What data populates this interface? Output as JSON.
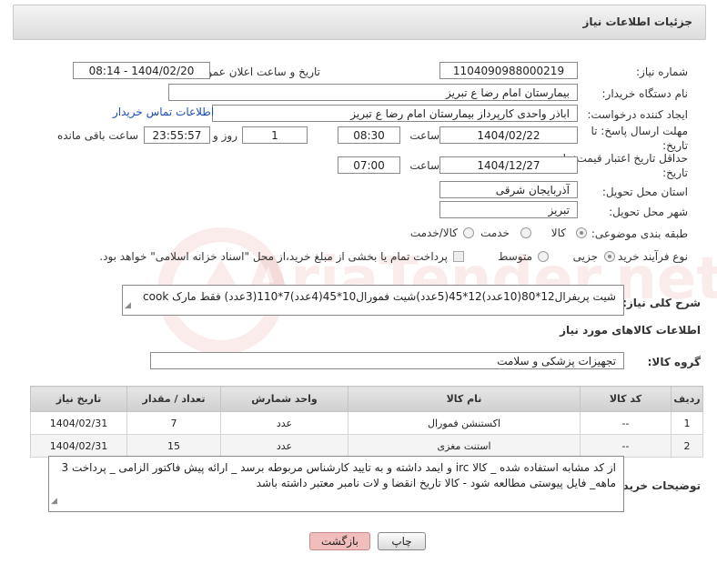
{
  "header": {
    "title": "جزئیات اطلاعات نیاز"
  },
  "fields": {
    "need_number_label": "شماره نیاز:",
    "need_number": "1104090988000219",
    "announce_label": "تاریخ و ساعت اعلان عمومی:",
    "announce_value": "1404/02/20 - 08:14",
    "buyer_label": "نام دستگاه خریدار:",
    "buyer_value": "بیمارستان امام رضا  ع  تبریز",
    "creator_label": "ایجاد کننده درخواست:",
    "creator_value": "اباذر واحدی کارپرداز بیمارستان امام رضا  ع  تبریز",
    "contact_link": "اطلاعات تماس خریدار",
    "reply_deadline_label": "مهلت ارسال پاسخ: تا تاریخ:",
    "reply_date": "1404/02/22",
    "time_label": "ساعت",
    "reply_time": "08:30",
    "days_value": "1",
    "days_label": "روز و",
    "remaining_time": "23:55:57",
    "remaining_label": "ساعت باقی مانده",
    "price_validity_label": "حداقل تاریخ اعتبار قیمت: تا تاریخ:",
    "price_date": "1404/12/27",
    "price_time": "07:00",
    "province_label": "استان محل تحویل:",
    "province_value": "آذربایجان شرقی",
    "city_label": "شهر محل تحویل:",
    "city_value": "تبریز",
    "category_label": "طبقه بندی موضوعی:",
    "category_options": [
      "کالا",
      "خدمت",
      "کالا/خدمت"
    ],
    "process_label": "نوع فرآیند خرید :",
    "process_options": [
      "جزیی",
      "متوسط"
    ],
    "payment_note": "پرداخت تمام یا بخشی از مبلغ خرید،از محل \"اسناد خزانه اسلامی\" خواهد بود.",
    "summary_label": "شرح کلی نیاز:",
    "summary_value": "شیت پریفرال12*80(10عدد)12*45(5عدد)شیت فمورال10*45(4عدد)7*110(3عدد) فقط مارک cook",
    "goods_info_title": "اطلاعات کالاهای مورد نیاز",
    "goods_group_label": "گروه کالا:",
    "goods_group_value": "تجهیزات پزشکی و سلامت"
  },
  "table": {
    "headers": [
      "ردیف",
      "کد کالا",
      "نام کالا",
      "واحد شمارش",
      "تعداد / مقدار",
      "تاریخ نیاز"
    ],
    "rows": [
      [
        "1",
        "--",
        "اکستنشن فمورال",
        "عدد",
        "7",
        "1404/02/31"
      ],
      [
        "2",
        "--",
        "استنت مغزی",
        "عدد",
        "15",
        "1404/02/31"
      ]
    ]
  },
  "buyer_notes": {
    "label": "توضیحات خریدار:",
    "text": "از کد مشابه استفاده شده _ کالا irc و ایمد داشته و به تایید کارشناس مربوطه برسد _ ارائه پیش فاکتور الزامی _ پرداخت 3 ماهه_ فایل پیوستی مطالعه شود - کالا تاریخ انقضا و لات نامبر معتبر داشته باشد"
  },
  "buttons": {
    "print": "چاپ",
    "back": "بازگشت"
  },
  "watermark": "AriaTender.net"
}
